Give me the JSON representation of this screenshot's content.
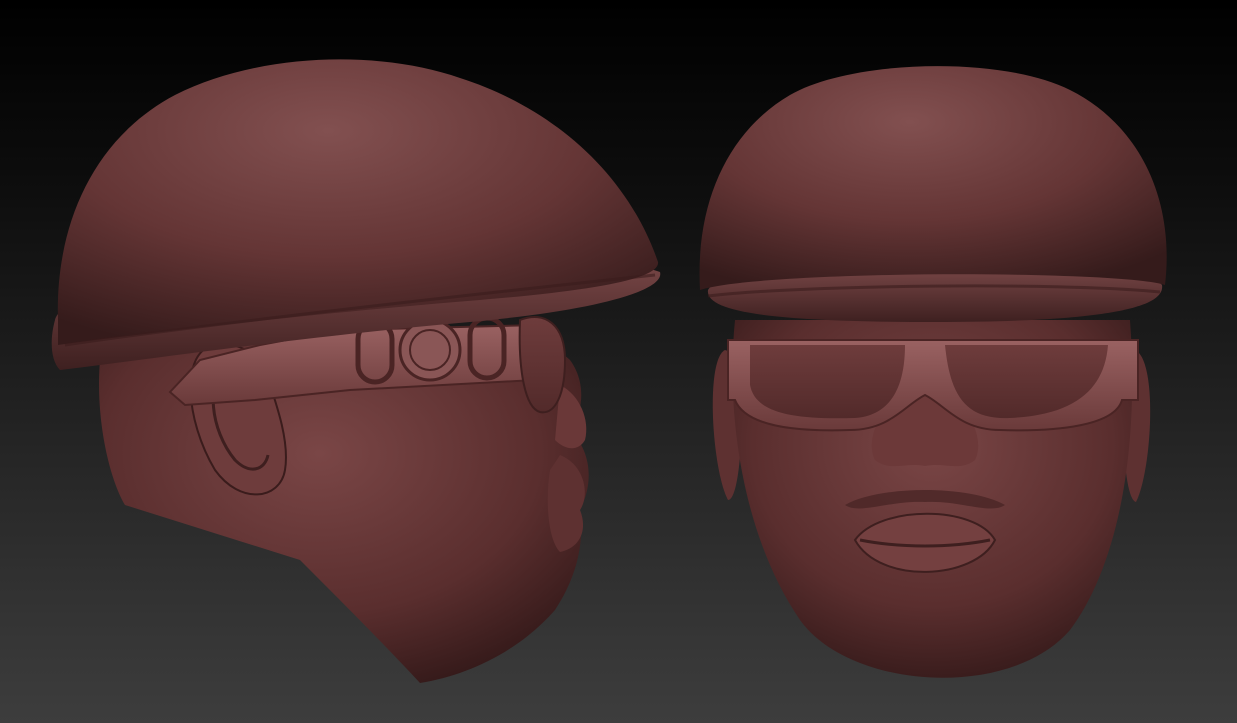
{
  "scene": {
    "background_gradient": [
      "#000000",
      "#3d3d3d"
    ],
    "material_color": "#6b3a3a",
    "material_shadow": "#2a1414",
    "material_highlight": "#8a5252",
    "views": [
      "side-profile",
      "front"
    ]
  }
}
